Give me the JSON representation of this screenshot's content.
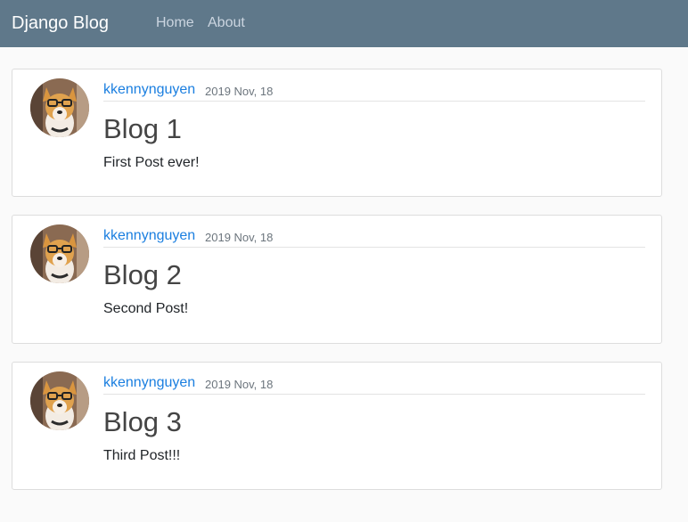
{
  "navbar": {
    "brand": "Django Blog",
    "links": [
      {
        "label": "Home"
      },
      {
        "label": "About"
      }
    ],
    "background": "#5f788a"
  },
  "posts": [
    {
      "author": "kkennynguyen",
      "date": "2019 Nov, 18",
      "title": "Blog 1",
      "content": "First Post ever!"
    },
    {
      "author": "kkennynguyen",
      "date": "2019 Nov, 18",
      "title": "Blog 2",
      "content": "Second Post!"
    },
    {
      "author": "kkennynguyen",
      "date": "2019 Nov, 18",
      "title": "Blog 3",
      "content": "Third Post!!!"
    }
  ],
  "colors": {
    "author_link": "#1b7fe0",
    "page_background": "#fafafa"
  }
}
